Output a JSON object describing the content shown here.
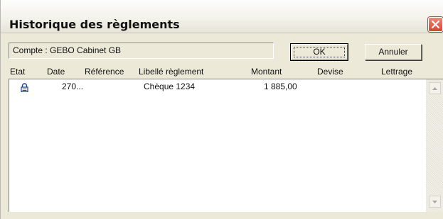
{
  "window": {
    "title": "Historique des règlements"
  },
  "account": {
    "text": "Compte : GEBO Cabinet GB"
  },
  "buttons": {
    "ok_label": "OK",
    "cancel_label": "Annuler"
  },
  "table": {
    "columns": [
      "Etat",
      "Date",
      "Référence",
      "Libellé règlement",
      "Montant",
      "Devise",
      "Lettrage"
    ],
    "rows": [
      {
        "etat_icon": "lock-icon",
        "date": "270...",
        "reference": "",
        "libelle": "Chèque 1234",
        "montant": "1 885,00",
        "devise": "",
        "lettrage": ""
      }
    ]
  },
  "icons": {
    "close": "close-icon",
    "lock": "lock-icon",
    "scroll_up": "scroll-up-icon",
    "scroll_down": "scroll-down-icon"
  },
  "colors": {
    "window_bg": "#ece9d8",
    "close_button": "#d2462e",
    "lock_icon": "#1e3c9c"
  }
}
